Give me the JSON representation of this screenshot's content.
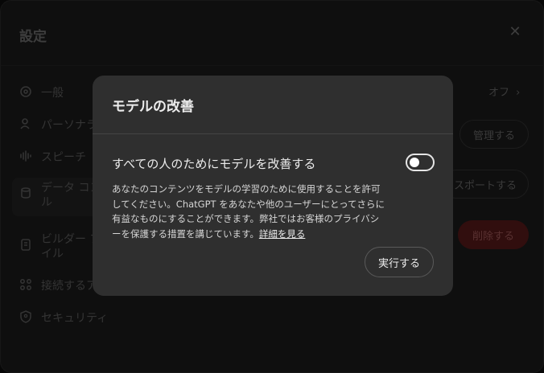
{
  "settings": {
    "title": "設定",
    "close_icon": "close-icon",
    "sidebar": [
      {
        "label": "一般",
        "icon": "gear-icon"
      },
      {
        "label": "パーソナラ",
        "icon": "person-icon"
      },
      {
        "label": "スピーチ",
        "icon": "waveform-icon"
      },
      {
        "label": "データ コン\nル",
        "icon": "database-icon"
      },
      {
        "label": "ビルダー プ\nイル",
        "icon": "id-card-icon"
      },
      {
        "label": "接続するア",
        "icon": "grid-icon"
      },
      {
        "label": "セキュリティ",
        "icon": "shield-icon"
      }
    ],
    "right": {
      "off_value": "オフ",
      "manage_button": "管理する",
      "export_button": "スポートする",
      "delete_button": "削除する"
    }
  },
  "modal": {
    "title": "モデルの改善",
    "setting_label": "すべての人のためにモデルを改善する",
    "toggle_state": "off",
    "description": "あなたのコンテンツをモデルの学習のために使用することを許可してください。ChatGPT をあなたや他のユーザーにとってさらに有益なものにすることができます。弊社ではお客様のプライバシーを保護する措置を講じています。",
    "learn_more_link": "詳細を見る",
    "execute_button": "実行する"
  },
  "colors": {
    "modal_bg": "#2f2f2f",
    "delete_red": "#5a1a1a",
    "text_primary": "#ececec"
  }
}
